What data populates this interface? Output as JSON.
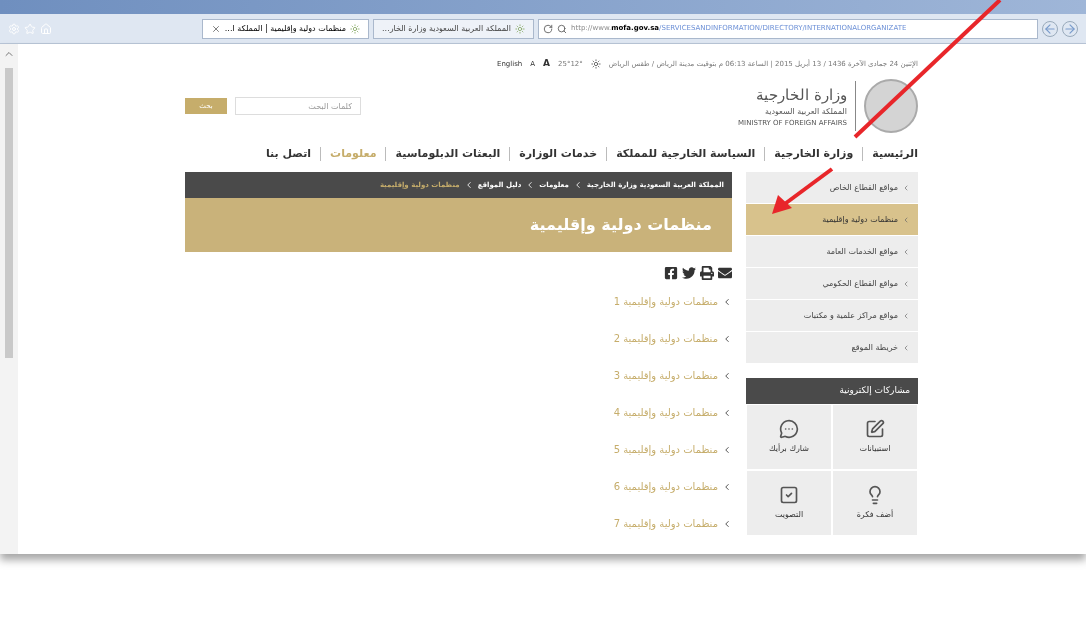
{
  "browser": {
    "tabs": [
      {
        "label": "المملكة العربية السعودية وزارة الخار...",
        "selected": false
      },
      {
        "label": "منظمات دولية وإقليمية | المملكة ا...",
        "selected": true
      }
    ],
    "url_prefix": "http://www.",
    "url_domain": "mofa.gov.sa",
    "url_path": "/SERVICESANDINFORMATION/DIRECTORY/INTERNATIONALORGANIZATE"
  },
  "top_bar": {
    "info": "الإثنين 24 جمادى الآخرة 1436 / 13 أبريل 2015 | الساعة 06:13 م بتوقيت مدينة الرياض / طقس الرياض",
    "temperature": "25°12°",
    "language": "English",
    "font_small": "A",
    "font_large": "A"
  },
  "logo": {
    "title": "وزارة الخارجية",
    "subtitle": "المملكة العربية السعودية",
    "english": "MINISTRY OF FOREIGN AFFAIRS"
  },
  "search": {
    "placeholder": "كلمات البحث",
    "button": "بحث"
  },
  "nav": [
    {
      "label": "الرئيسية",
      "selected": false
    },
    {
      "label": "وزارة الخارجية",
      "selected": false
    },
    {
      "label": "السياسة الخارجية للمملكة",
      "selected": false
    },
    {
      "label": "خدمات الوزارة",
      "selected": false
    },
    {
      "label": "البعثات الدبلوماسية",
      "selected": false
    },
    {
      "label": "معلومات",
      "selected": true
    },
    {
      "label": "اتصل بنا",
      "selected": false
    }
  ],
  "breadcrumb": [
    {
      "label": "المملكة العربية السعودية وزارة الخارجية",
      "selected": false
    },
    {
      "label": "معلومات",
      "selected": false
    },
    {
      "label": "دليل المواقع",
      "selected": false
    },
    {
      "label": "منظمات دولية وإقليمية",
      "selected": true
    }
  ],
  "page_title": "منظمات دولية وإقليمية",
  "links": [
    "منظمات دولية وإقليمية 1",
    "منظمات دولية وإقليمية 2",
    "منظمات دولية وإقليمية 3",
    "منظمات دولية وإقليمية 4",
    "منظمات دولية وإقليمية 5",
    "منظمات دولية وإقليمية 6",
    "منظمات دولية وإقليمية 7"
  ],
  "sidebar": [
    {
      "label": "مواقع القطاع الخاص",
      "selected": false
    },
    {
      "label": "منظمات دولية وإقليمية",
      "selected": true
    },
    {
      "label": "مواقع الخدمات العامة",
      "selected": false
    },
    {
      "label": "مواقع القطاع الحكومي",
      "selected": false
    },
    {
      "label": "مواقع مراكز علمية و مكتبات",
      "selected": false
    },
    {
      "label": "خريطة الموقع",
      "selected": false
    }
  ],
  "participation": {
    "title": "مشاركات إلكترونية",
    "tiles": [
      {
        "kind": "survey",
        "label": "استبيانات"
      },
      {
        "kind": "opinion",
        "label": "شارك برأيك"
      },
      {
        "kind": "idea",
        "label": "أضف فكرة"
      },
      {
        "kind": "vote",
        "label": "التصويت"
      }
    ]
  }
}
